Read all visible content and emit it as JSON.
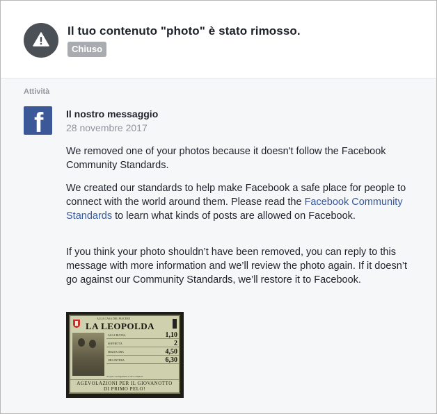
{
  "header": {
    "title": "Il tuo contenuto \"photo\" è stato rimosso.",
    "status_badge": "Chiuso",
    "icon": "warning-icon"
  },
  "activity": {
    "section_label": "Attività",
    "message": {
      "sender": "Il nostro messaggio",
      "date": "28 novembre 2017",
      "paragraph1": "We removed one of your photos because it doesn't follow the Facebook Community Standards.",
      "paragraph2_before_link": "We created our standards to help make Facebook a safe place for people to connect with the world around them. Please read the ",
      "paragraph2_link": "Facebook Community Standards",
      "paragraph2_after_link": " to learn what kinds of posts are allowed on Facebook.",
      "paragraph3": "If you think your photo shouldn’t have been removed, you can reply to this message with more information and we’ll review the photo again. If it doesn’t go against our Community Standards, we’ll restore it to Facebook."
    },
    "photo": {
      "top_caption": "ALLA CASA DEL PIACERE",
      "title": "LA LEOPOLDA",
      "prices": [
        {
          "label": "ALLA BUONA",
          "value": "1,10"
        },
        {
          "label": "SOFFIETTA",
          "value": "2"
        },
        {
          "label": "MEZZA ORA",
          "value": "4,50"
        },
        {
          "label": "ORA INTERA",
          "value": "6,30"
        }
      ],
      "note": "Acqua e asciugamani a sala completa",
      "footer_line1": "AGEVOLAZIONI PER IL GIOVANOTTO",
      "footer_line2": "DI PRIMO PELO!"
    }
  },
  "colors": {
    "facebook_blue": "#3b5998",
    "link": "#365899",
    "badge_bg": "#a8abaf",
    "activity_bg": "#f6f7f9"
  }
}
